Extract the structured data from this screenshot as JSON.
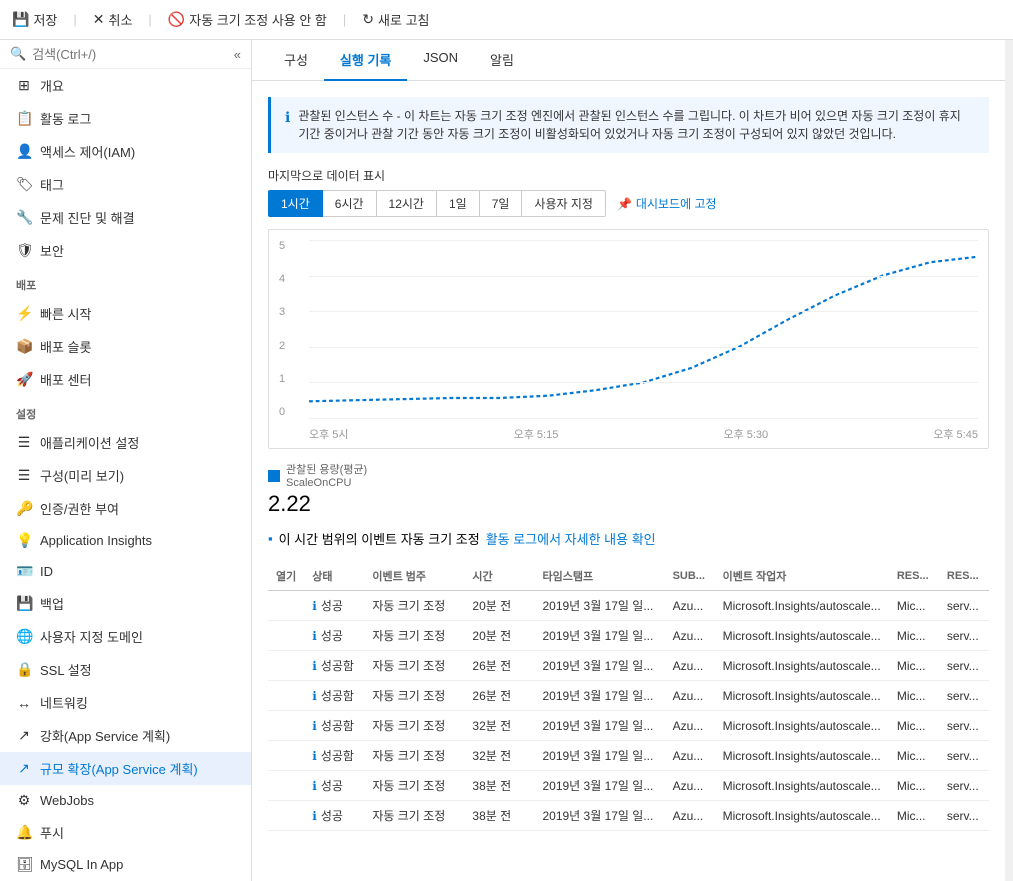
{
  "toolbar": {
    "save_label": "저장",
    "cancel_label": "취소",
    "autoscale_label": "자동 크기 조정 사용 안 함",
    "refresh_label": "새로 고침",
    "save_icon": "💾",
    "cancel_icon": "✕",
    "autoscale_icon": "🚫",
    "refresh_icon": "↻"
  },
  "tabs": [
    {
      "id": "config",
      "label": "구성"
    },
    {
      "id": "run-history",
      "label": "실행 기록",
      "active": true
    },
    {
      "id": "json",
      "label": "JSON"
    },
    {
      "id": "alerts",
      "label": "알림"
    }
  ],
  "info_box": {
    "text": "관찰된 인스턴스 수 - 이 차트는 자동 크기 조정 엔진에서 관찰된 인스턴스 수를 그립니다. 이 차트가 비어 있으면 자동 크기 조정이 휴지 기간 중이거나 관찰 기간 동안 자동 크기 조정이 비활성화되어 있었거나 자동 크기 조정이 구성되어 있지 않았던 것입니다."
  },
  "time_range": {
    "label": "마지막으로 데이터 표시",
    "options": [
      "1시간",
      "6시간",
      "12시간",
      "1일",
      "7일",
      "사용자 지정"
    ],
    "active": "1시간",
    "dashboard_pin": "대시보드에 고정"
  },
  "chart": {
    "y_labels": [
      "5",
      "4",
      "3",
      "2",
      "1",
      "0"
    ],
    "x_labels": [
      "오후 5시",
      "오후 5:15",
      "오후 5:30",
      "오후 5:45"
    ],
    "legend_label": "관찰된 용량(평균)",
    "legend_sublabel": "ScaleOnCPU",
    "value": "2.22"
  },
  "activity_log": {
    "prefix": "이 시간 범위의 이벤트 자동 크기 조정",
    "link_text": "활동 로그에서 자세한 내용 확인"
  },
  "table": {
    "headers": [
      "열기",
      "상태",
      "이벤트 범주",
      "시간",
      "타임스탬프",
      "SUB...",
      "이벤트 작업자",
      "RES...",
      "RES..."
    ],
    "rows": [
      {
        "status_icon": "ℹ",
        "status": "성공",
        "category": "자동 크기 조정",
        "time": "20분 전",
        "timestamp": "2019년 3월 17일 일...",
        "sub": "Azu...",
        "resource": "Microsoft.Insights/autoscale...",
        "res1": "Mic...",
        "res2": "serv..."
      },
      {
        "status_icon": "ℹ",
        "status": "성공",
        "category": "자동 크기 조정",
        "time": "20분 전",
        "timestamp": "2019년 3월 17일 일...",
        "sub": "Azu...",
        "resource": "Microsoft.Insights/autoscale...",
        "res1": "Mic...",
        "res2": "serv..."
      },
      {
        "status_icon": "ℹ",
        "status": "성공함",
        "category": "자동 크기 조정",
        "time": "26분 전",
        "timestamp": "2019년 3월 17일 일...",
        "sub": "Azu...",
        "resource": "Microsoft.Insights/autoscale...",
        "res1": "Mic...",
        "res2": "serv..."
      },
      {
        "status_icon": "ℹ",
        "status": "성공함",
        "category": "자동 크기 조정",
        "time": "26분 전",
        "timestamp": "2019년 3월 17일 일...",
        "sub": "Azu...",
        "resource": "Microsoft.Insights/autoscale...",
        "res1": "Mic...",
        "res2": "serv..."
      },
      {
        "status_icon": "ℹ",
        "status": "성공함",
        "category": "자동 크기 조정",
        "time": "32분 전",
        "timestamp": "2019년 3월 17일 일...",
        "sub": "Azu...",
        "resource": "Microsoft.Insights/autoscale...",
        "res1": "Mic...",
        "res2": "serv..."
      },
      {
        "status_icon": "ℹ",
        "status": "성공함",
        "category": "자동 크기 조정",
        "time": "32분 전",
        "timestamp": "2019년 3월 17일 일...",
        "sub": "Azu...",
        "resource": "Microsoft.Insights/autoscale...",
        "res1": "Mic...",
        "res2": "serv..."
      },
      {
        "status_icon": "ℹ",
        "status": "성공",
        "category": "자동 크기 조정",
        "time": "38분 전",
        "timestamp": "2019년 3월 17일 일...",
        "sub": "Azu...",
        "resource": "Microsoft.Insights/autoscale...",
        "res1": "Mic...",
        "res2": "serv..."
      },
      {
        "status_icon": "ℹ",
        "status": "성공",
        "category": "자동 크기 조정",
        "time": "38분 전",
        "timestamp": "2019년 3월 17일 일...",
        "sub": "Azu...",
        "resource": "Microsoft.Insights/autoscale...",
        "res1": "Mic...",
        "res2": "serv..."
      }
    ]
  },
  "sidebar": {
    "search_placeholder": "검색(Ctrl+/)",
    "collapse_icon": "«",
    "items": [
      {
        "id": "overview",
        "label": "개요",
        "icon": "⊞"
      },
      {
        "id": "activity-log",
        "label": "활동 로그",
        "icon": "📋"
      },
      {
        "id": "iam",
        "label": "액세스 제어(IAM)",
        "icon": "👤"
      },
      {
        "id": "tags",
        "label": "태그",
        "icon": "🏷"
      },
      {
        "id": "diagnose",
        "label": "문제 진단 및 해결",
        "icon": "🔧"
      },
      {
        "id": "security",
        "label": "보안",
        "icon": "🛡"
      }
    ],
    "sections": [
      {
        "header": "배포",
        "items": [
          {
            "id": "quickstart",
            "label": "빠른 시작",
            "icon": "⚡"
          },
          {
            "id": "deploy-slots",
            "label": "배포 슬롯",
            "icon": "📦"
          },
          {
            "id": "deploy-center",
            "label": "배포 센터",
            "icon": "🚀"
          }
        ]
      },
      {
        "header": "설정",
        "items": [
          {
            "id": "app-settings",
            "label": "애플리케이션 설정",
            "icon": "☰"
          },
          {
            "id": "config-preview",
            "label": "구성(미리 보기)",
            "icon": "☰"
          },
          {
            "id": "auth",
            "label": "인증/권한 부여",
            "icon": "🔑"
          },
          {
            "id": "app-insights",
            "label": "Application Insights",
            "icon": "💡"
          },
          {
            "id": "id",
            "label": "ID",
            "icon": "🪪"
          },
          {
            "id": "backup",
            "label": "백업",
            "icon": "💾"
          },
          {
            "id": "custom-domain",
            "label": "사용자 지정 도메인",
            "icon": "🌐"
          },
          {
            "id": "ssl",
            "label": "SSL 설정",
            "icon": "🔒"
          },
          {
            "id": "networking",
            "label": "네트워킹",
            "icon": "↔"
          },
          {
            "id": "app-service-plan",
            "label": "강화(App Service 계획)",
            "icon": "↗"
          },
          {
            "id": "scale-out",
            "label": "규모 확장(App Service 계획)",
            "icon": "↗",
            "active": true
          },
          {
            "id": "webjobs",
            "label": "WebJobs",
            "icon": "⚙"
          },
          {
            "id": "push",
            "label": "푸시",
            "icon": "🔔"
          },
          {
            "id": "mysql",
            "label": "MySQL In App",
            "icon": "🗄"
          }
        ]
      }
    ]
  }
}
